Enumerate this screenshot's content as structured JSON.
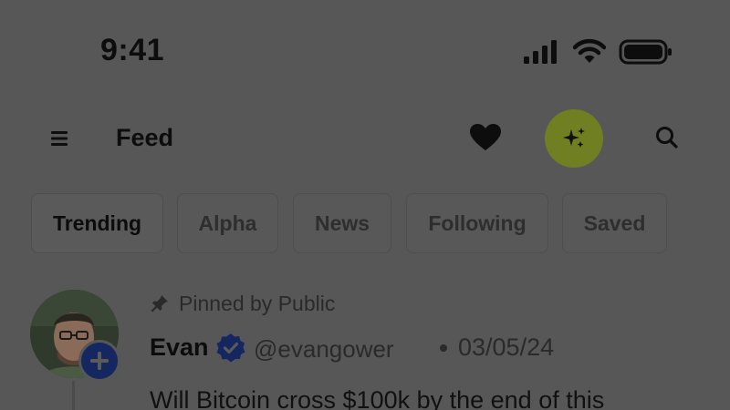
{
  "status_bar": {
    "time": "9:41",
    "icons": [
      "signal-icon",
      "wifi-icon",
      "battery-icon"
    ]
  },
  "header": {
    "menu_icon": "hamburger-menu-icon",
    "title": "Feed",
    "actions": [
      "heart-icon",
      "sparkles-icon",
      "search-icon"
    ]
  },
  "tabs": [
    {
      "label": "Trending",
      "active": true
    },
    {
      "label": "Alpha",
      "active": false
    },
    {
      "label": "News",
      "active": false
    },
    {
      "label": "Following",
      "active": false
    },
    {
      "label": "Saved",
      "active": false
    }
  ],
  "post": {
    "pinned_label": "Pinned by Public",
    "author_name": "Evan",
    "verified": true,
    "handle": "@evangower",
    "date": "03/05/24",
    "text": "Will Bitcoin cross $100k by the end of this"
  },
  "colors": {
    "overlay_background": "#575757",
    "ai_button": "#707f22",
    "verified_badge": "#142760",
    "follow_badge": "#142760"
  }
}
